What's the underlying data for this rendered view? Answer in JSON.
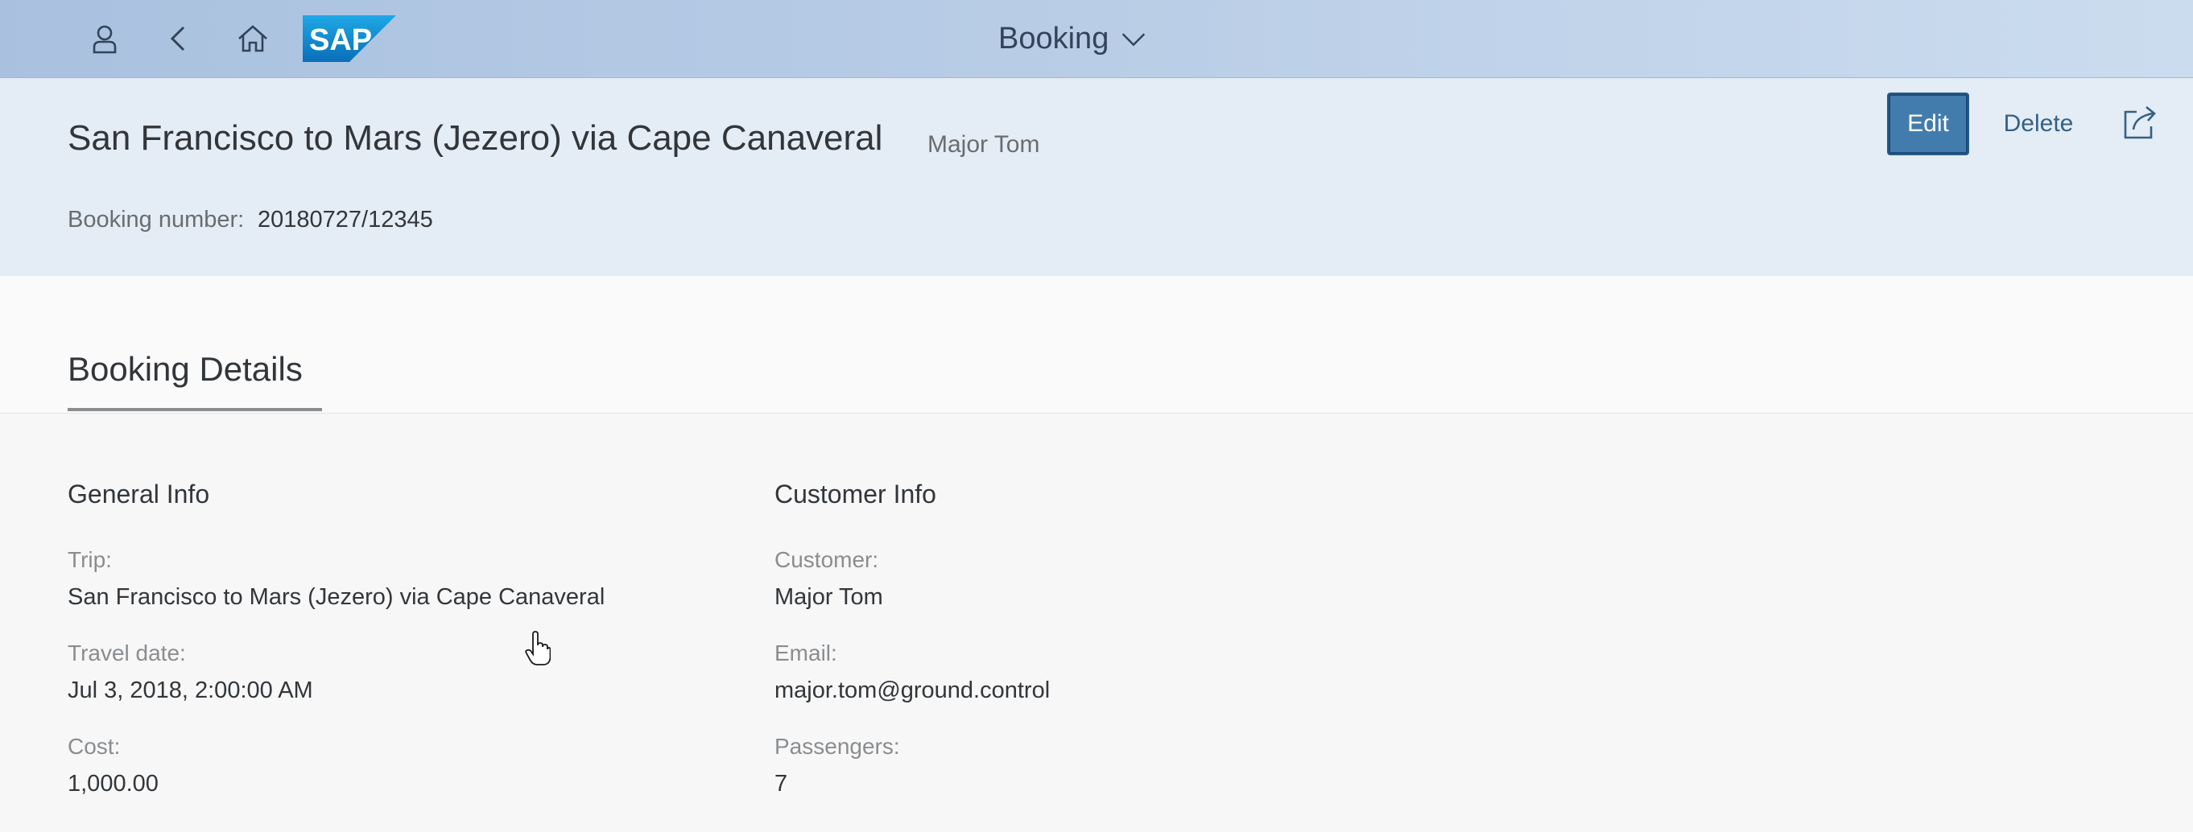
{
  "shell": {
    "title": "Booking",
    "icons": [
      "user-icon",
      "back-icon",
      "home-icon",
      "sap-logo",
      "chevron-down-icon"
    ],
    "logo_text": "SAP"
  },
  "header": {
    "title": "San Francisco to Mars (Jezero) via Cape Canaveral",
    "subtitle": "Major Tom",
    "booking_number_label": "Booking number:",
    "booking_number_value": "20180727/12345",
    "actions": {
      "edit_label": "Edit",
      "delete_label": "Delete",
      "share_icon": "share-icon"
    },
    "colors": {
      "edit_button": "#427cac",
      "header_background": "#e4ecf5",
      "shell_background": "#b9cde6"
    }
  },
  "section": {
    "tab_label": "Booking Details"
  },
  "general_info": {
    "title": "General Info",
    "trip_label": "Trip:",
    "trip_value": "San Francisco to Mars (Jezero) via Cape Canaveral",
    "travel_date_label": "Travel date:",
    "travel_date_value": "Jul 3, 2018, 2:00:00 AM",
    "cost_label": "Cost:",
    "cost_value": "1,000.00"
  },
  "customer_info": {
    "title": "Customer Info",
    "customer_label": "Customer:",
    "customer_value": "Major Tom",
    "email_label": "Email:",
    "email_value": "major.tom@ground.control",
    "passengers_label": "Passengers:",
    "passengers_value": "7"
  }
}
